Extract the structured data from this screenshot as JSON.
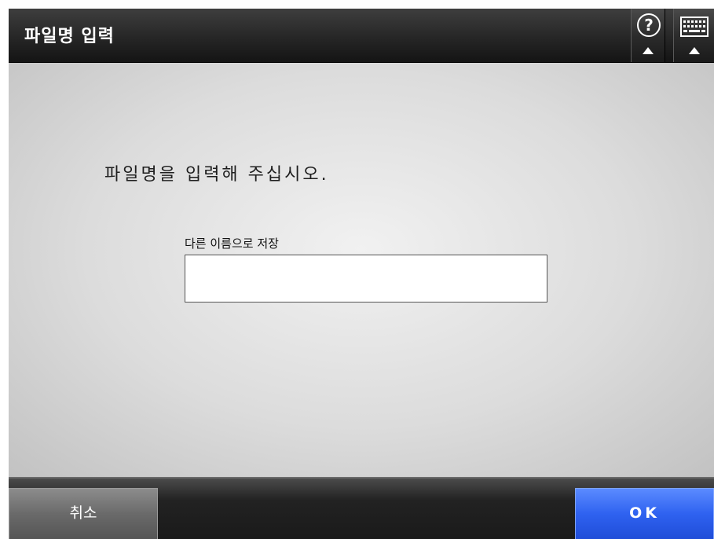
{
  "header": {
    "title": "파일명 입력",
    "help_icon": "help-icon",
    "keyboard_icon": "keyboard-icon"
  },
  "main": {
    "prompt": "파일명을 입력해 주십시오.",
    "field_label": "다른 이름으로 저장",
    "filename_value": ""
  },
  "footer": {
    "cancel_label": "취소",
    "ok_label": "OK"
  },
  "colors": {
    "ok_button": "#2f62f0",
    "cancel_button": "#6a6a6a",
    "header": "#262626"
  }
}
